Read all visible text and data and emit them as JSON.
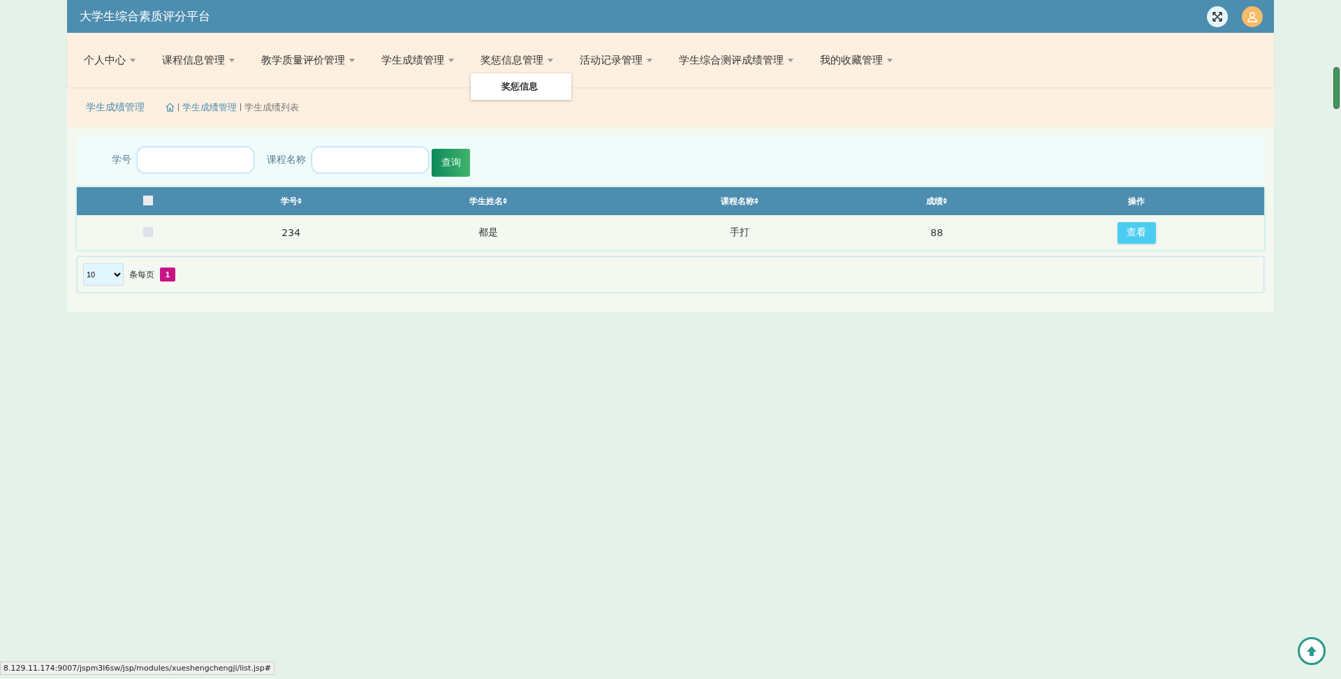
{
  "header": {
    "title": "大学生综合素质评分平台"
  },
  "nav": [
    {
      "label": "个人中心"
    },
    {
      "label": "课程信息管理"
    },
    {
      "label": "教学质量评价管理"
    },
    {
      "label": "学生成绩管理"
    },
    {
      "label": "奖惩信息管理",
      "children": [
        "奖惩信息"
      ]
    },
    {
      "label": "活动记录管理"
    },
    {
      "label": "学生综合测评成绩管理"
    },
    {
      "label": "我的收藏管理"
    }
  ],
  "breadcrumb": {
    "title": "学生成绩管理",
    "path": [
      "学生成绩管理",
      "学生成绩列表"
    ]
  },
  "search": {
    "fields": [
      {
        "label": "学号"
      },
      {
        "label": "课程名称"
      }
    ],
    "button": "查询"
  },
  "table": {
    "all_checked": false,
    "columns": [
      {
        "label": "学号",
        "sortable": true
      },
      {
        "label": "学生姓名",
        "sortable": true
      },
      {
        "label": "课程名称",
        "sortable": true
      },
      {
        "label": "成绩",
        "sortable": true
      },
      {
        "label": "操作",
        "sortable": false
      }
    ],
    "rows": [
      {
        "checked": false,
        "cells": [
          "234",
          "都是",
          "手打",
          "88"
        ],
        "action": "查看"
      }
    ]
  },
  "pagination": {
    "page_size": "10",
    "per_page_label": "条每页",
    "pages": [
      {
        "label": "1",
        "selected": true
      }
    ]
  },
  "status_bar": {
    "url": "8.129.11.174:9007/jspm3l6sw/jsp/modules/xueshengchengji/list.jsp#"
  }
}
